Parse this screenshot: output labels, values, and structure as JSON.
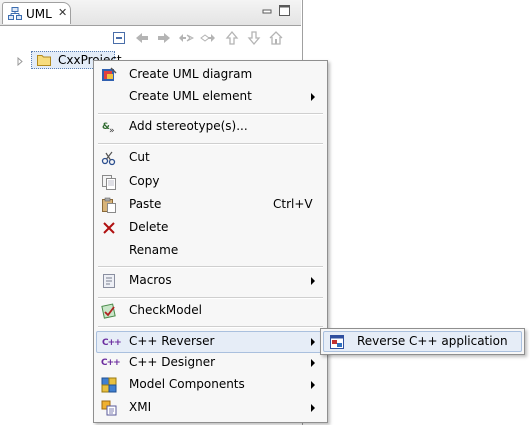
{
  "view": {
    "tab_title": "UML",
    "tab_close": "✕"
  },
  "tree": {
    "project_label": "CxxProject"
  },
  "context_menu": {
    "items": [
      {
        "label": "Create UML diagram",
        "icon": "uml-diagram-icon"
      },
      {
        "label": "Create UML element",
        "icon": "none",
        "submenu": true
      },
      {
        "label": "Add stereotype(s)...",
        "icon": "stereotype-icon"
      },
      {
        "label": "Cut",
        "icon": "scissors-icon"
      },
      {
        "label": "Copy",
        "icon": "copy-icon"
      },
      {
        "label": "Paste",
        "icon": "paste-icon",
        "shortcut": "Ctrl+V"
      },
      {
        "label": "Delete",
        "icon": "delete-x-icon"
      },
      {
        "label": "Rename",
        "icon": "rename-icon"
      },
      {
        "label": "Macros",
        "icon": "macros-icon",
        "submenu": true
      },
      {
        "label": "CheckModel",
        "icon": "checkmodel-icon"
      },
      {
        "label": "C++ Reverser",
        "icon": "cpp-icon",
        "submenu": true
      },
      {
        "label": "C++ Designer",
        "icon": "cpp-icon",
        "submenu": true
      },
      {
        "label": "Model Components",
        "icon": "model-components-icon",
        "submenu": true
      },
      {
        "label": "XMI",
        "icon": "xmi-icon",
        "submenu": true
      }
    ]
  },
  "submenu": {
    "label": "Reverse C++ application",
    "icon": "reverse-app-icon"
  },
  "colors": {
    "hover_bg": "#e6edf7",
    "hover_border": "#aac0de",
    "menu_bg": "#f7f7f7",
    "cpp_purple": "#6a2a9e"
  }
}
